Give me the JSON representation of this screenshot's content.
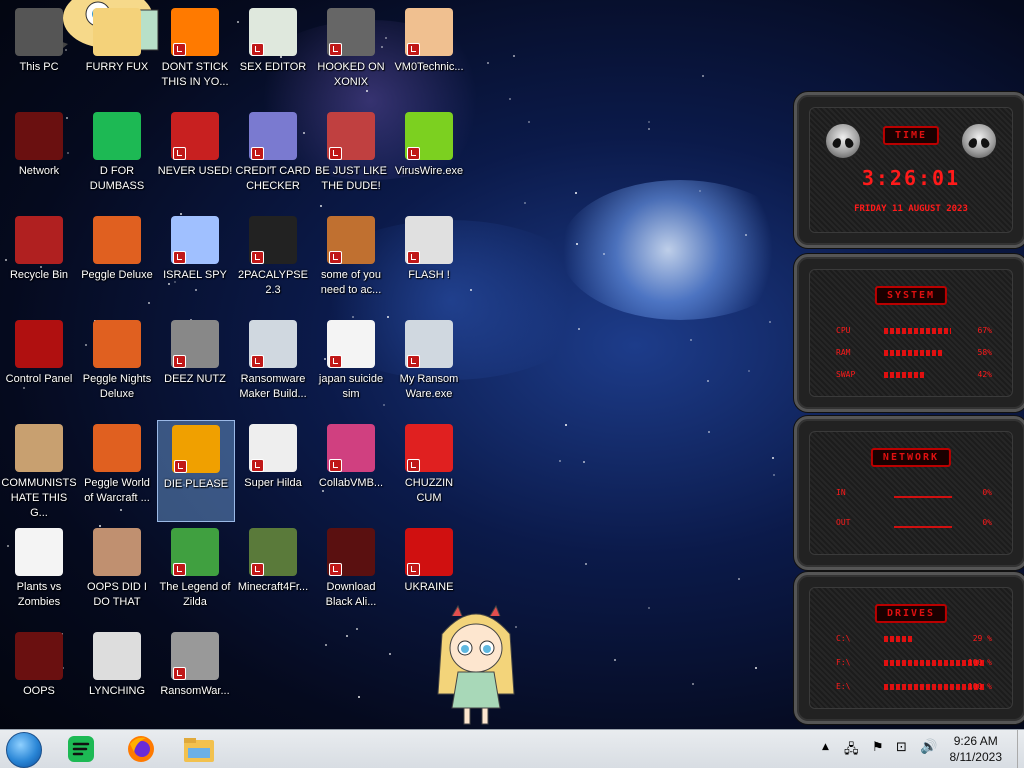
{
  "desktop": {
    "icons": [
      {
        "label": "This PC",
        "icon": "computer-icon"
      },
      {
        "label": "FURRY FUX",
        "icon": "cartoon-icon"
      },
      {
        "label": "DONT STICK THIS IN YO...",
        "icon": "traffic-cone-icon"
      },
      {
        "label": "SEX EDITOR",
        "icon": "hxd-editor-icon"
      },
      {
        "label": "HOOKED ON XONIX",
        "icon": "game-icon"
      },
      {
        "label": "VM0Technic...",
        "icon": "doctor-icon"
      },
      {
        "label": "Network",
        "icon": "network-icon"
      },
      {
        "label": "D FOR DUMBASS",
        "icon": "green-chat-icon"
      },
      {
        "label": "NEVER USED!",
        "icon": "dev-cpp-icon"
      },
      {
        "label": "CREDIT CARD CHECKER",
        "icon": "credit-card-icon"
      },
      {
        "label": "BE JUST LIKE THE DUDE!",
        "icon": "santa-icon"
      },
      {
        "label": "VirusWire.exe",
        "icon": "lime-icon"
      },
      {
        "label": "Recycle Bin",
        "icon": "recycle-bin-icon"
      },
      {
        "label": "Peggle Deluxe",
        "icon": "peggle-icon"
      },
      {
        "label": "ISRAEL SPY",
        "icon": "spy-icon"
      },
      {
        "label": "2PACALYPSE 2.3",
        "icon": "terminal-icon"
      },
      {
        "label": "some of you need to ac...",
        "icon": "dog-icon"
      },
      {
        "label": "FLASH !",
        "icon": "flash-icon"
      },
      {
        "label": "Control Panel",
        "icon": "control-panel-icon"
      },
      {
        "label": "Peggle Nights Deluxe",
        "icon": "peggle-icon"
      },
      {
        "label": "DEEZ NUTZ",
        "icon": "windows-stack-icon"
      },
      {
        "label": "Ransomware Maker Build...",
        "icon": "window-app-icon"
      },
      {
        "label": "japan suicide sim",
        "icon": "file-icon"
      },
      {
        "label": "My Ransom Ware.exe",
        "icon": "window-app-icon"
      },
      {
        "label": "COMMUNISTS HATE THIS G...",
        "icon": "money-bag-icon"
      },
      {
        "label": "Peggle World of Warcraft ...",
        "icon": "peggle-icon"
      },
      {
        "label": "DIE PLEASE",
        "icon": "de-icon"
      },
      {
        "label": "Super Hilda",
        "icon": "pixel-dog-icon"
      },
      {
        "label": "CollabVMB...",
        "icon": "monitor-icon"
      },
      {
        "label": "CHUZZIN CUM",
        "icon": "chuzzle-icon"
      },
      {
        "label": "Plants vs Zombies",
        "icon": "flower-icon"
      },
      {
        "label": "OOPS DID I DO THAT",
        "icon": "portrait-icon"
      },
      {
        "label": "The Legend of Zilda",
        "icon": "pixel-hero-icon"
      },
      {
        "label": "Minecraft4Fr...",
        "icon": "grass-block-icon"
      },
      {
        "label": "Download Black Ali...",
        "icon": "alien-icon"
      },
      {
        "label": "UKRAINE",
        "icon": "radiation-icon"
      },
      {
        "label": "OOPS",
        "icon": "skull-box-icon"
      },
      {
        "label": "LYNCHING",
        "icon": "noose-icon"
      },
      {
        "label": "RansomWar...",
        "icon": "skull-icon"
      }
    ]
  },
  "widgets": {
    "time": {
      "title": "TIME",
      "clock": "3:26:01",
      "date": "FRIDAY 11 AUGUST 2023"
    },
    "system": {
      "title": "SYSTEM",
      "rows": [
        {
          "key": "CPU",
          "value": "67%",
          "fill": 0.67
        },
        {
          "key": "RAM",
          "value": "58%",
          "fill": 0.58
        },
        {
          "key": "SWAP",
          "value": "42%",
          "fill": 0.42
        }
      ]
    },
    "network": {
      "title": "NETWORK",
      "rows": [
        {
          "key": "IN",
          "value": "0%"
        },
        {
          "key": "OUT",
          "value": "0%"
        }
      ]
    },
    "drives": {
      "title": "DRIVES",
      "rows": [
        {
          "key": "C:\\",
          "value": "29 %",
          "fill": 0.29
        },
        {
          "key": "F:\\",
          "value": "100 %",
          "fill": 1.0
        },
        {
          "key": "E:\\",
          "value": "100 %",
          "fill": 1.0
        }
      ]
    }
  },
  "taskbar": {
    "pinned": [
      "start-orb-icon",
      "green-chat-icon",
      "firefox-icon",
      "file-explorer-icon"
    ],
    "tray": [
      "chevron-up-icon",
      "network-tray-icon",
      "flag-icon",
      "display-icon",
      "volume-icon"
    ],
    "time": "9:26 AM",
    "date": "8/11/2023"
  },
  "colors": {
    "accent_red": "#ff1a1a",
    "taskbar": "#dfe3e8",
    "selection": "#7aaae6"
  }
}
